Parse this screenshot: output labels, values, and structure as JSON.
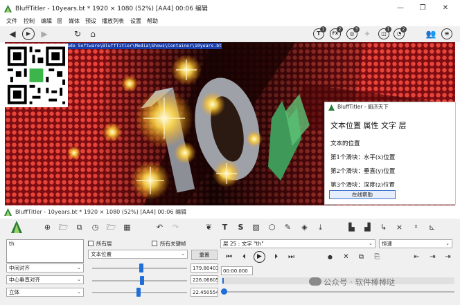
{
  "window": {
    "title": "BluffTitler - 10years.bt * 1920 × 1080 (52%) [AA4] 00:06 编辑",
    "controls": [
      "—",
      "❐",
      "✕"
    ]
  },
  "menu": [
    "文件",
    "控制",
    "编辑",
    "层",
    "媒体",
    "预设",
    "播放列表",
    "设置",
    "帮助"
  ],
  "toolbar": {
    "badges": [
      "1",
      "2",
      "3",
      "1",
      "2"
    ],
    "right_labels": [
      "T",
      "FX",
      "◎"
    ]
  },
  "viewport": {
    "path_text": "ade Software\\BluffTitler\\Media\\Shows\\Container\\10years.bt",
    "graphic_text": "10"
  },
  "popup": {
    "title": "BluffTitler - 阁济天下",
    "heading": "文本位置 属性 文字 层",
    "lines": [
      "文本的位置",
      "第1个滑块：水平(x)位置",
      "第2个滑块：垂直(y)位置",
      "第3个滑块：深度(z)位置"
    ],
    "button": "在线帮助"
  },
  "editor": {
    "title": "BluffTitler - 10years.bt * 1920 × 1080 (52%) [AA4] 00:06 编辑",
    "toolbar_letters": [
      "T",
      "S"
    ],
    "text_value": "th",
    "chk_all_layers": "所有层",
    "chk_all_keyframes": "所有关键帧",
    "property": "文本位置",
    "reset": "重置",
    "layer": "层   25   : 文字 \"th\"",
    "ease": "恒速",
    "time": "00:00.000",
    "left_combos": [
      "中间对齐",
      "中心垂直对齐",
      "立体"
    ],
    "values": [
      "179.80403",
      "226.06605",
      "22.450554"
    ]
  },
  "watermark": "公众号 · 软件棒棒哒",
  "colors": {
    "accent": "#1e6fd9",
    "path_highlight": "#1a3eaa",
    "viewport_red": "#b0191e"
  }
}
